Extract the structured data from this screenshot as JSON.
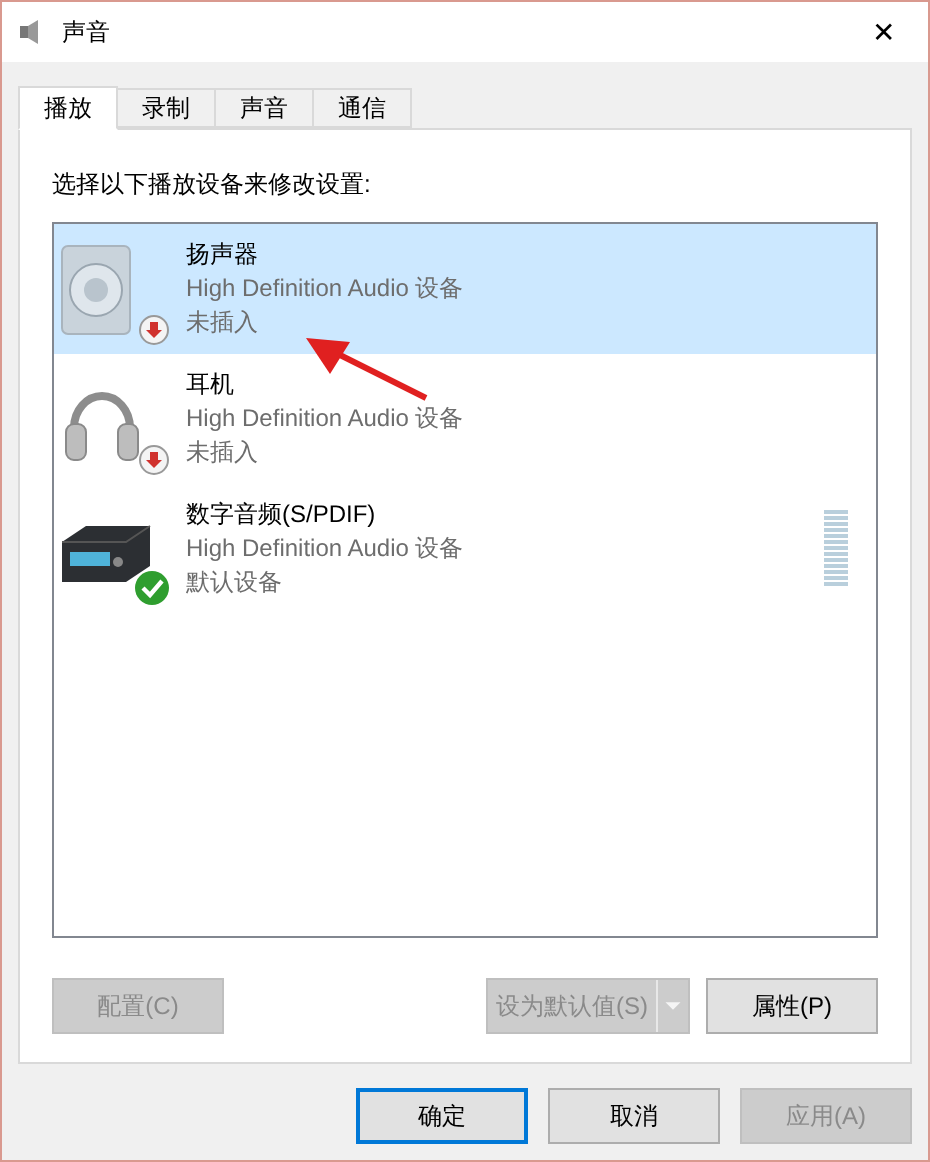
{
  "window": {
    "title": "声音",
    "close": "✕"
  },
  "tabs": [
    {
      "label": "播放",
      "selected": true
    },
    {
      "label": "录制",
      "selected": false
    },
    {
      "label": "声音",
      "selected": false
    },
    {
      "label": "通信",
      "selected": false
    }
  ],
  "instruction": "选择以下播放设备来修改设置:",
  "devices": [
    {
      "kind": "speaker",
      "name": "扬声器",
      "driver": "High Definition Audio 设备",
      "status_text": "未插入",
      "badge": {
        "kind": "unplugged"
      },
      "selected": true,
      "meter": false
    },
    {
      "kind": "headphones",
      "name": "耳机",
      "driver": "High Definition Audio 设备",
      "status_text": "未插入",
      "badge": {
        "kind": "unplugged"
      },
      "selected": false,
      "meter": false
    },
    {
      "kind": "receiver",
      "name": "数字音频(S/PDIF)",
      "driver": "High Definition Audio 设备",
      "status_text": "默认设备",
      "badge": {
        "kind": "default"
      },
      "selected": false,
      "meter": true
    }
  ],
  "panel_buttons": {
    "configure": {
      "label": "配置(C)",
      "disabled": true
    },
    "set_default": {
      "label": "设为默认值(S)",
      "disabled": true
    },
    "properties": {
      "label": "属性(P)",
      "disabled": false
    }
  },
  "dialog_buttons": [
    {
      "label": "确定",
      "disabled": false,
      "default": true
    },
    {
      "label": "取消",
      "disabled": false,
      "default": false
    },
    {
      "label": "应用(A)",
      "disabled": true,
      "default": false
    }
  ],
  "annotation_arrow": true
}
